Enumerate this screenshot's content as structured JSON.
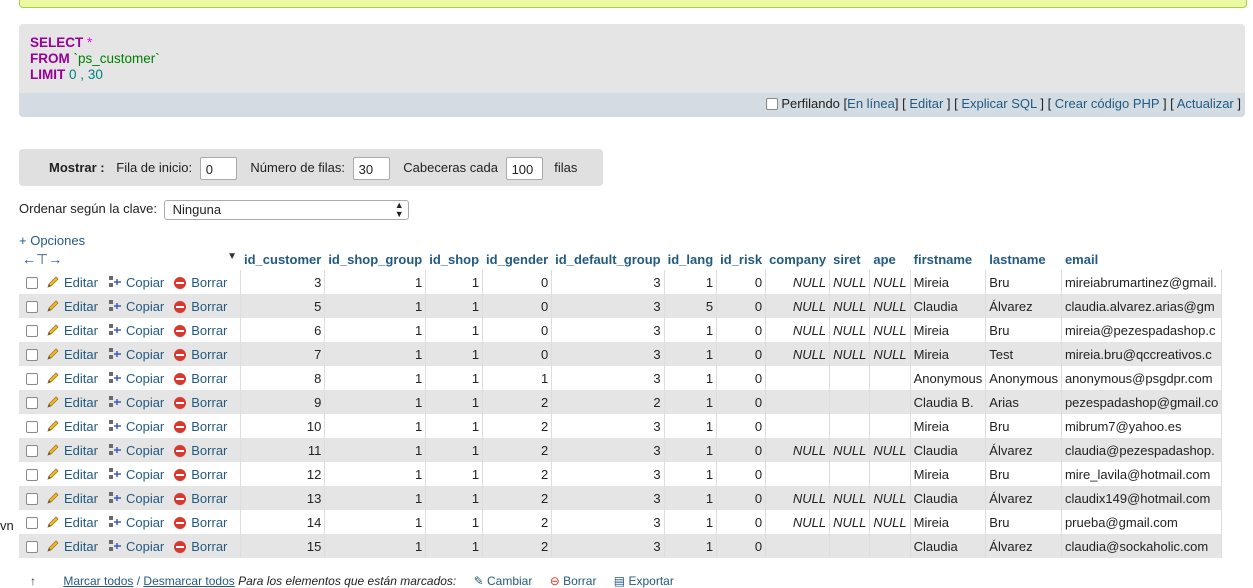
{
  "sql": {
    "select_kw": "SELECT",
    "star": "*",
    "from_kw": "FROM",
    "table": "`ps_customer`",
    "limit_kw": "LIMIT",
    "limit_start": "0",
    "limit_sep": ",",
    "limit_count": "30"
  },
  "sql_links": {
    "profiling": "Perfilando",
    "inline": "En línea",
    "edit": "Editar",
    "explain": "Explicar SQL",
    "php": "Crear código PHP",
    "refresh": "Actualizar"
  },
  "nav": {
    "show_label": "Mostrar :",
    "start_label": "Fila de inicio:",
    "start_value": "0",
    "rows_label": "Número de filas:",
    "rows_value": "30",
    "headers_label": "Cabeceras cada",
    "headers_value": "100",
    "rows_suffix": "filas"
  },
  "sort": {
    "label": "Ordenar según la clave:",
    "value": "Ninguna"
  },
  "options_link": "+ Opciones",
  "actions": {
    "edit": "Editar",
    "copy": "Copiar",
    "delete": "Borrar"
  },
  "columns": [
    "id_customer",
    "id_shop_group",
    "id_shop",
    "id_gender",
    "id_default_group",
    "id_lang",
    "id_risk",
    "company",
    "siret",
    "ape",
    "firstname",
    "lastname",
    "email"
  ],
  "rows": [
    [
      "3",
      "1",
      "1",
      "0",
      "3",
      "1",
      "0",
      "NULL",
      "NULL",
      "NULL",
      "Mireia",
      "Bru",
      "mireiabrumartinez@gmail."
    ],
    [
      "5",
      "1",
      "1",
      "0",
      "3",
      "5",
      "0",
      "NULL",
      "NULL",
      "NULL",
      "Claudia",
      "Álvarez",
      "claudia.alvarez.arias@gm"
    ],
    [
      "6",
      "1",
      "1",
      "0",
      "3",
      "1",
      "0",
      "NULL",
      "NULL",
      "NULL",
      "Mireia",
      "Bru",
      "mireia@pezespadashop.c"
    ],
    [
      "7",
      "1",
      "1",
      "0",
      "3",
      "1",
      "0",
      "NULL",
      "NULL",
      "NULL",
      "Mireia",
      "Test",
      "mireia.bru@qccreativos.c"
    ],
    [
      "8",
      "1",
      "1",
      "1",
      "3",
      "1",
      "0",
      "",
      "",
      "",
      "Anonymous",
      "Anonymous",
      "anonymous@psgdpr.com"
    ],
    [
      "9",
      "1",
      "1",
      "2",
      "2",
      "1",
      "0",
      "",
      "",
      "",
      "Claudia B.",
      "Arias",
      "pezespadashop@gmail.co"
    ],
    [
      "10",
      "1",
      "1",
      "2",
      "3",
      "1",
      "0",
      "",
      "",
      "",
      "Mireia",
      "Bru",
      "mibrum7@yahoo.es"
    ],
    [
      "11",
      "1",
      "1",
      "2",
      "3",
      "1",
      "0",
      "NULL",
      "NULL",
      "NULL",
      "Claudia",
      "Álvarez",
      "claudia@pezespadashop."
    ],
    [
      "12",
      "1",
      "1",
      "2",
      "3",
      "1",
      "0",
      "",
      "",
      "",
      "Mireia",
      "Bru",
      "mire_lavila@hotmail.com"
    ],
    [
      "13",
      "1",
      "1",
      "2",
      "3",
      "1",
      "0",
      "NULL",
      "NULL",
      "NULL",
      "Claudia",
      "Álvarez",
      "claudix149@hotmail.com"
    ],
    [
      "14",
      "1",
      "1",
      "2",
      "3",
      "1",
      "0",
      "NULL",
      "NULL",
      "NULL",
      "Mireia",
      "Bru",
      "prueba@gmail.com"
    ],
    [
      "15",
      "1",
      "1",
      "2",
      "3",
      "1",
      "0",
      "",
      "",
      "",
      "Claudia",
      "Álvarez",
      "claudia@sockaholic.com"
    ]
  ],
  "bottom": {
    "check_all": "Marcar todos",
    "sep": "/",
    "uncheck_all": "Desmarcar todos",
    "with_selected": "Para los elementos que están marcados:",
    "change": "Cambiar",
    "delete": "Borrar",
    "export": "Exportar"
  },
  "left_cut_text": "vn"
}
